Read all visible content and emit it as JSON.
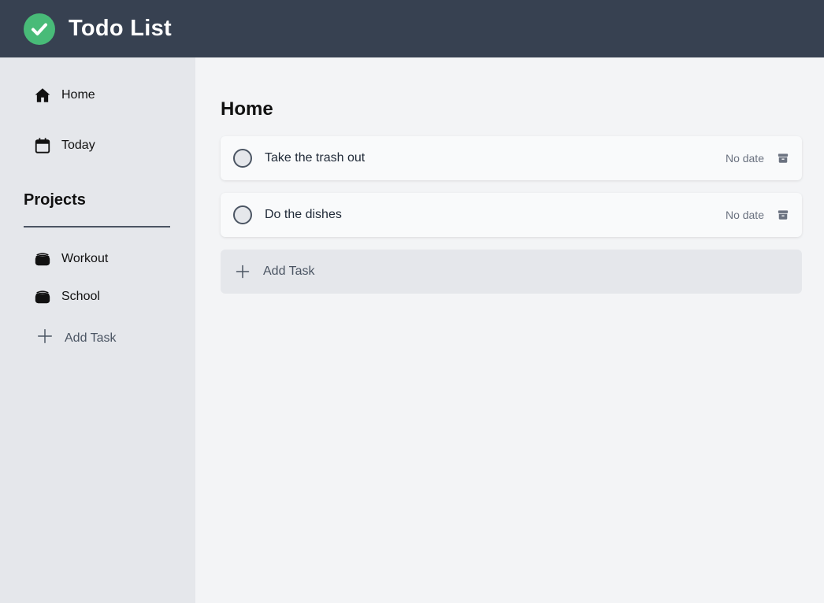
{
  "header": {
    "title": "Todo List",
    "logo_icon": "check-circle-icon",
    "logo_color": "#48bb78",
    "bar_color": "#374151"
  },
  "sidebar": {
    "nav": [
      {
        "label": "Home",
        "icon": "home-icon"
      },
      {
        "label": "Today",
        "icon": "calendar-icon"
      }
    ],
    "projects_heading": "Projects",
    "projects": [
      {
        "label": "Workout",
        "icon": "stack-icon"
      },
      {
        "label": "School",
        "icon": "stack-icon"
      }
    ],
    "add_label": "Add Task"
  },
  "main": {
    "title": "Home",
    "tasks": [
      {
        "title": "Take the trash out",
        "date": "No date",
        "archive_icon": "archive-icon"
      },
      {
        "title": "Do the dishes",
        "date": "No date",
        "archive_icon": "archive-icon"
      }
    ],
    "add_label": "Add Task"
  }
}
